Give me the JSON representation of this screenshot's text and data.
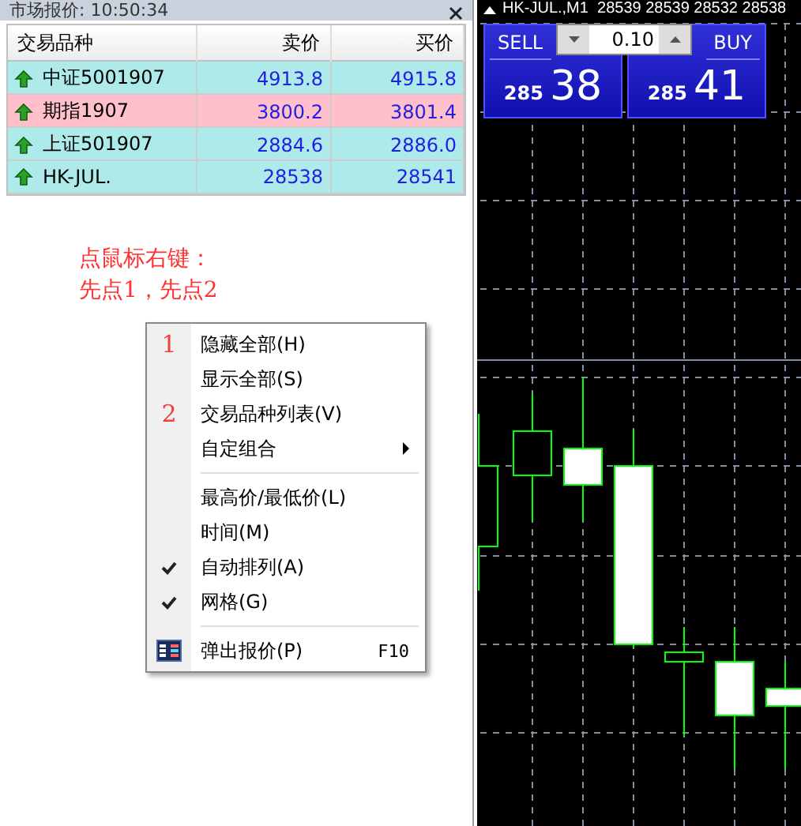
{
  "market_watch": {
    "title": "市场报价: 10:50:34",
    "columns": [
      "交易品种",
      "卖价",
      "买价"
    ],
    "rows": [
      {
        "symbol": "中证5001907",
        "bid": "4913.8",
        "ask": "4915.8",
        "color": "#aeeaea"
      },
      {
        "symbol": "期指1907",
        "bid": "3800.2",
        "ask": "3801.4",
        "color": "#ffc0cb"
      },
      {
        "symbol": "上证501907",
        "bid": "2884.6",
        "ask": "2886.0",
        "color": "#aeeaea"
      },
      {
        "symbol": "HK-JUL.",
        "bid": "28538",
        "ask": "28541",
        "color": "#aeeaea"
      }
    ]
  },
  "annotation": [
    "点鼠标右键：",
    "先点1，先点2"
  ],
  "context_menu": [
    {
      "kind": "item",
      "label": "隐藏全部(H)",
      "marker": "1",
      "checked": false,
      "submenu": false
    },
    {
      "kind": "item",
      "label": "显示全部(S)",
      "checked": false,
      "submenu": false
    },
    {
      "kind": "item",
      "label": "交易品种列表(V)",
      "marker": "2",
      "checked": false,
      "submenu": false
    },
    {
      "kind": "item",
      "label": "自定组合",
      "checked": false,
      "submenu": true
    },
    {
      "kind": "separator"
    },
    {
      "kind": "item",
      "label": "最高价/最低价(L)",
      "checked": false,
      "submenu": false
    },
    {
      "kind": "item",
      "label": "时间(M)",
      "checked": false,
      "submenu": false
    },
    {
      "kind": "item",
      "label": "自动排列(A)",
      "checked": true,
      "submenu": false
    },
    {
      "kind": "item",
      "label": "网格(G)",
      "checked": true,
      "submenu": false
    },
    {
      "kind": "separator"
    },
    {
      "kind": "icon",
      "label": "弹出报价(P)",
      "shortcut": "F10",
      "checked": false,
      "submenu": false
    }
  ],
  "chart": {
    "header": "HK-JUL.,M1  28539 28539 28532 28538",
    "sell_label": "SELL",
    "buy_label": "BUY",
    "volume": "0.10",
    "sell_price_small": "285",
    "sell_price_big": "38",
    "buy_price_small": "285",
    "buy_price_big": "41"
  }
}
